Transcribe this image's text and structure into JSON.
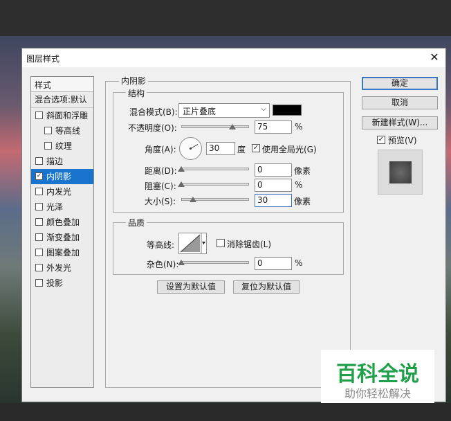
{
  "dialog": {
    "title": "图层样式",
    "close_glyph": "✕"
  },
  "style_list": {
    "header": "样式",
    "blend_options": "混合选项:默认",
    "items": [
      {
        "label": "斜面和浮雕",
        "checked": false,
        "indent": false
      },
      {
        "label": "等高线",
        "checked": false,
        "indent": true
      },
      {
        "label": "纹理",
        "checked": false,
        "indent": true
      },
      {
        "label": "描边",
        "checked": false,
        "indent": false
      },
      {
        "label": "内阴影",
        "checked": true,
        "indent": false,
        "selected": true
      },
      {
        "label": "内发光",
        "checked": false,
        "indent": false
      },
      {
        "label": "光泽",
        "checked": false,
        "indent": false
      },
      {
        "label": "颜色叠加",
        "checked": false,
        "indent": false
      },
      {
        "label": "渐变叠加",
        "checked": false,
        "indent": false
      },
      {
        "label": "图案叠加",
        "checked": false,
        "indent": false
      },
      {
        "label": "外发光",
        "checked": false,
        "indent": false
      },
      {
        "label": "投影",
        "checked": false,
        "indent": false
      }
    ]
  },
  "panel": {
    "section_title": "内阴影",
    "structure": {
      "title": "结构",
      "blend_mode_label": "混合模式(B):",
      "blend_mode_value": "正片叠底",
      "shadow_color": "#000000",
      "opacity_label": "不透明度(O):",
      "opacity_value": "75",
      "opacity_unit": "%",
      "opacity_level": 0.75,
      "angle_label": "角度(A):",
      "angle_value": "30",
      "angle_unit": "度",
      "global_light_label": "使用全局光(G)",
      "global_light_checked": true,
      "distance_label": "距离(D):",
      "distance_value": "0",
      "distance_unit": "像素",
      "choke_label": "阻塞(C):",
      "choke_value": "0",
      "choke_unit": "%",
      "size_label": "大小(S):",
      "size_value": "30",
      "size_unit": "像素"
    },
    "quality": {
      "title": "品质",
      "contour_label": "等高线:",
      "anti_alias_label": "消除锯齿(L)",
      "anti_alias_checked": false,
      "noise_label": "杂色(N):",
      "noise_value": "0",
      "noise_unit": "%"
    },
    "make_default_label": "设置为默认值",
    "reset_default_label": "复位为默认值"
  },
  "buttons": {
    "ok": "确定",
    "cancel": "取消",
    "new_style": "新建样式(W)...",
    "preview_label": "预览(V)",
    "preview_checked": true
  },
  "watermark": {
    "title": "百科全说",
    "subtitle": "助你轻松解决"
  }
}
